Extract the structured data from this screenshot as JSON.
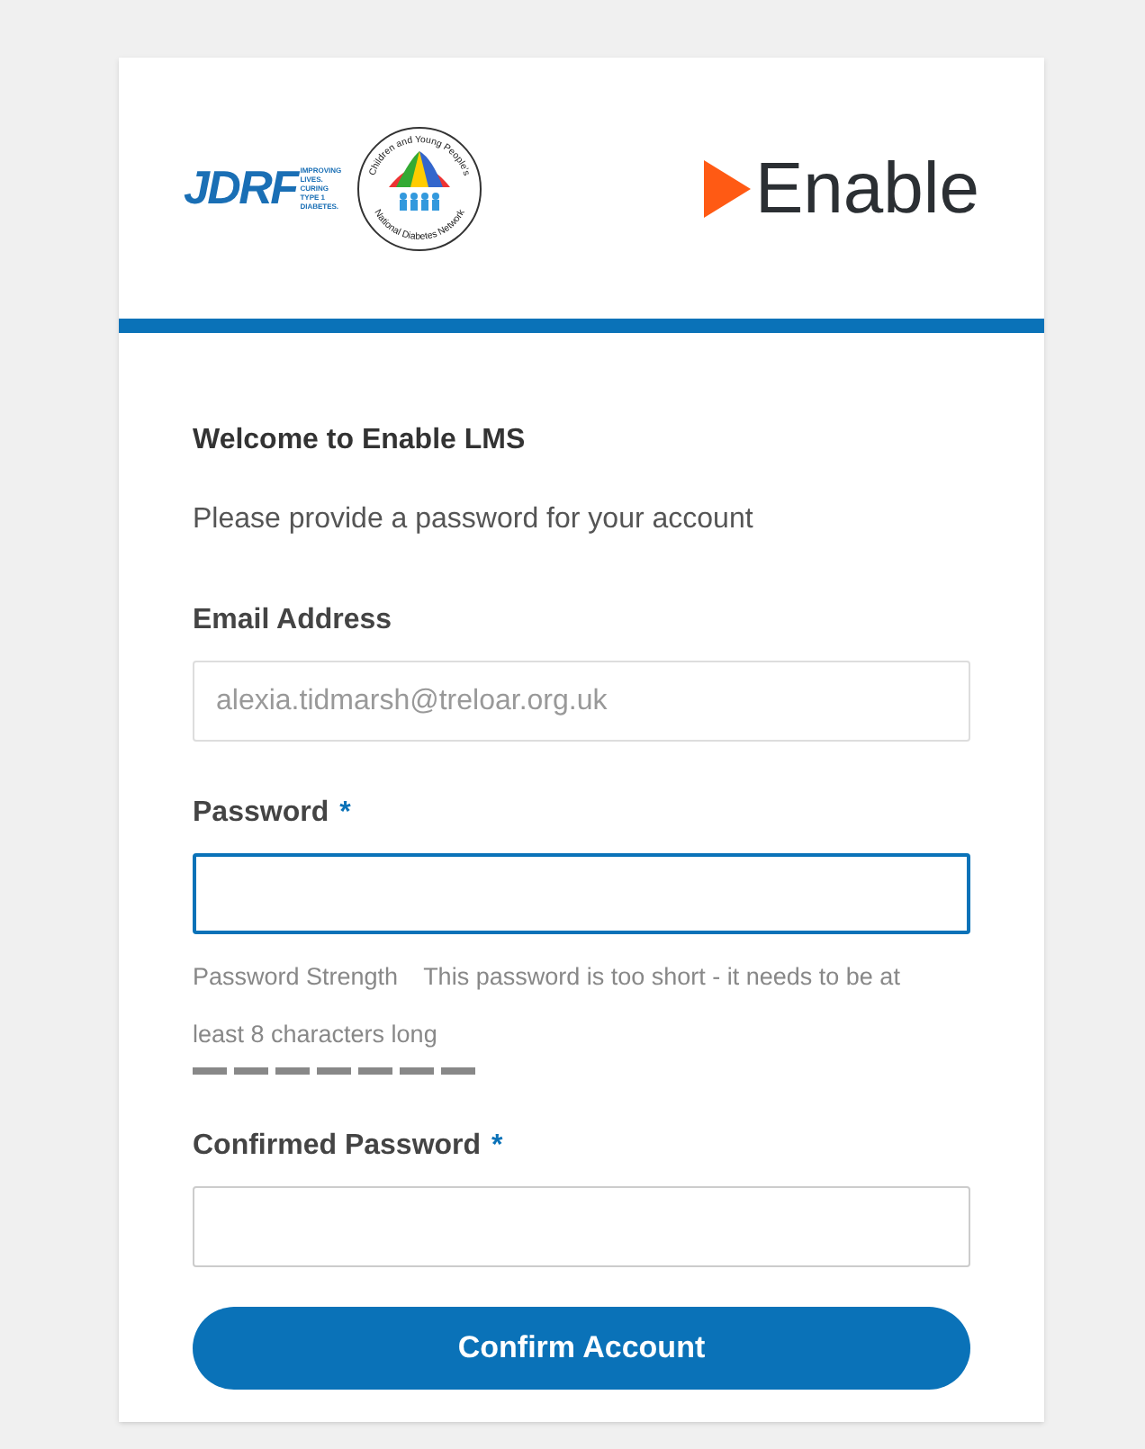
{
  "header": {
    "jdrf_logo": {
      "wordmark": "JDRF",
      "tagline": [
        "IMPROVING",
        "LIVES.",
        "CURING",
        "TYPE 1",
        "DIABETES."
      ]
    },
    "network_logo": {
      "top_text": "Children and Young People's",
      "bottom_text": "National Diabetes Network"
    },
    "brand": "Enable"
  },
  "form": {
    "title": "Welcome to Enable LMS",
    "subtitle": "Please provide a password for your account",
    "fields": [
      {
        "kind": "email",
        "label": "Email Address",
        "required": false,
        "value": "alexia.tidmarsh@treloar.org.uk",
        "disabled": true,
        "focused": false
      },
      {
        "kind": "password",
        "label": "Password",
        "required": true,
        "disabled": false,
        "focused": true,
        "strength": {
          "label": "Password Strength",
          "message": "This password is too short - it needs to be at least 8 characters long"
        }
      },
      {
        "kind": "password",
        "label": "Confirmed Password",
        "required": true,
        "disabled": false,
        "focused": false
      }
    ],
    "required_mark": "*",
    "submit": "Confirm Account"
  }
}
